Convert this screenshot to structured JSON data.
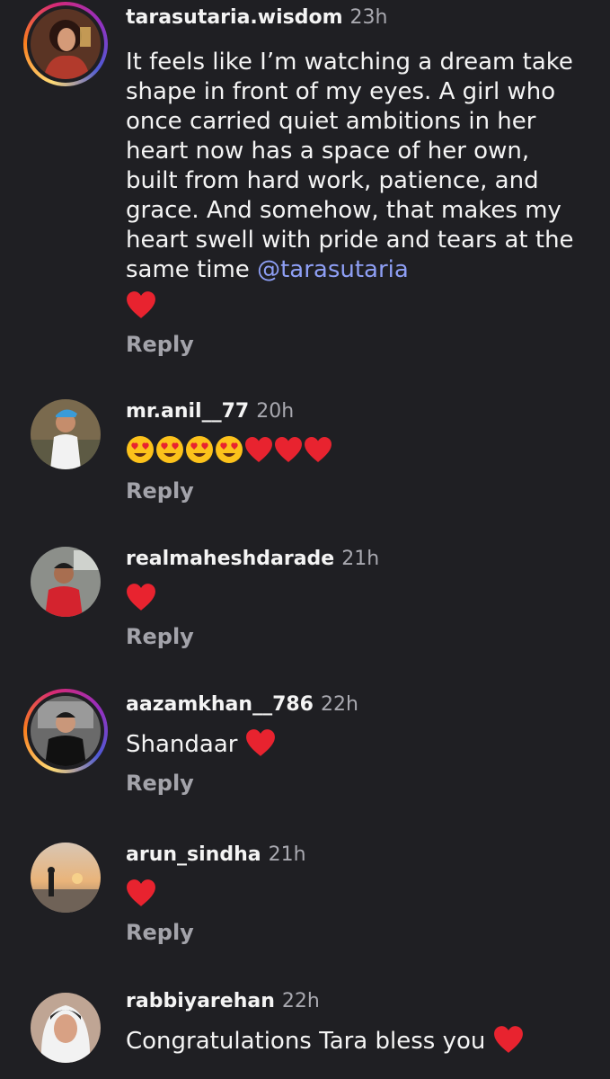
{
  "comments": [
    {
      "username": "tarasutaria.wisdom",
      "time": "23h",
      "text": "It feels like I’m watching a dream take shape in front of my eyes. A girl who once carried quiet ambitions in her heart now has a space of her own, built from hard work, patience, and grace. And somehow, that makes my heart swell with pride and tears at the same time",
      "mention_icon": "@",
      "mention": "tarasutaria",
      "reactions": [
        "red-heart"
      ],
      "reply": "Reply"
    },
    {
      "username": "mr.anil__77",
      "time": "20h",
      "reactions": [
        "heart-eyes",
        "heart-eyes",
        "heart-eyes",
        "heart-eyes",
        "red-heart",
        "red-heart",
        "red-heart"
      ],
      "reply": "Reply"
    },
    {
      "username": "realmaheshdarade",
      "time": "21h",
      "reactions": [
        "red-heart"
      ],
      "reply": "Reply"
    },
    {
      "username": "aazamkhan__786",
      "time": "22h",
      "text": "Shandaar",
      "reactions": [
        "red-heart"
      ],
      "reply": "Reply"
    },
    {
      "username": "arun_sindha",
      "time": "21h",
      "reactions": [
        "red-heart"
      ],
      "reply": "Reply"
    },
    {
      "username": "rabbiyarehan",
      "time": "22h",
      "text": "Congratulations Tara bless you",
      "reactions": [
        "red-heart"
      ]
    }
  ],
  "colors": {
    "background": "#1f1f23",
    "mention": "#8e9ff5",
    "heart": "#e8232f",
    "muted": "#a9a9b0"
  }
}
